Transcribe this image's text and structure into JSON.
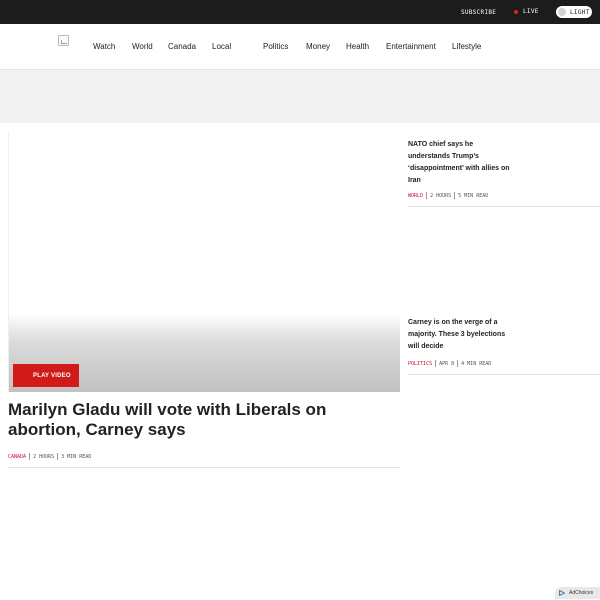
{
  "topbar": {
    "subscribe_label": "SUBSCRIBE",
    "live_label": "LIVE",
    "theme_label": "LIGHT"
  },
  "nav": {
    "items": [
      "Watch",
      "World",
      "Canada",
      "Local",
      "Politics",
      "Money",
      "Health",
      "Entertainment",
      "Lifestyle"
    ]
  },
  "hero": {
    "play_label": "PLAY VIDEO",
    "headline": "Marilyn Gladu will vote with Liberals on abortion, Carney says",
    "category": "CANADA",
    "time": "2 HOURS",
    "read_time": "3 MIN READ"
  },
  "side_stories": [
    {
      "title": "NATO chief says he understands Trump’s ‘disappointment’ with allies on Iran",
      "category": "WORLD",
      "time": "2 HOURS",
      "read_time": "5 MIN READ"
    },
    {
      "title": "Carney is on the verge of a majority. These 3 byelections will decide",
      "category": "POLITICS",
      "time": "APR 8",
      "read_time": "4 MIN READ"
    }
  ],
  "adchoices_label": "AdChoices",
  "colors": {
    "accent_red": "#d11b1b",
    "category_red": "#c8102e",
    "topbar_bg": "#1c1c1c"
  }
}
